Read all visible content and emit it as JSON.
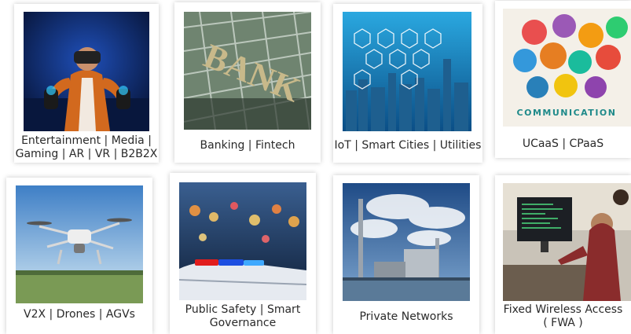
{
  "tiles": [
    {
      "id": "entertainment",
      "caption": [
        "Entertainment | Media |",
        "Gaming | AR | VR | B2B2X"
      ]
    },
    {
      "id": "banking",
      "caption": [
        "Banking | Fintech"
      ],
      "sign_text": "BANK"
    },
    {
      "id": "iot",
      "caption": [
        "IoT | Smart Cities | Utilities"
      ]
    },
    {
      "id": "ucaas",
      "caption": [
        "UCaaS |  CPaaS"
      ],
      "image_text": "COMMUNICATION"
    },
    {
      "id": "v2x",
      "caption": [
        "V2X | Drones | AGVs"
      ]
    },
    {
      "id": "public-safety",
      "caption": [
        "Public Safety | Smart",
        "Governance"
      ]
    },
    {
      "id": "private-networks",
      "caption": [
        "Private Networks"
      ]
    },
    {
      "id": "fwa",
      "caption": [
        "Fixed Wireless Access",
        "( FWA )"
      ]
    }
  ],
  "colors": {
    "caption_text": "#2a2a2a",
    "card_bg": "#ffffff"
  }
}
